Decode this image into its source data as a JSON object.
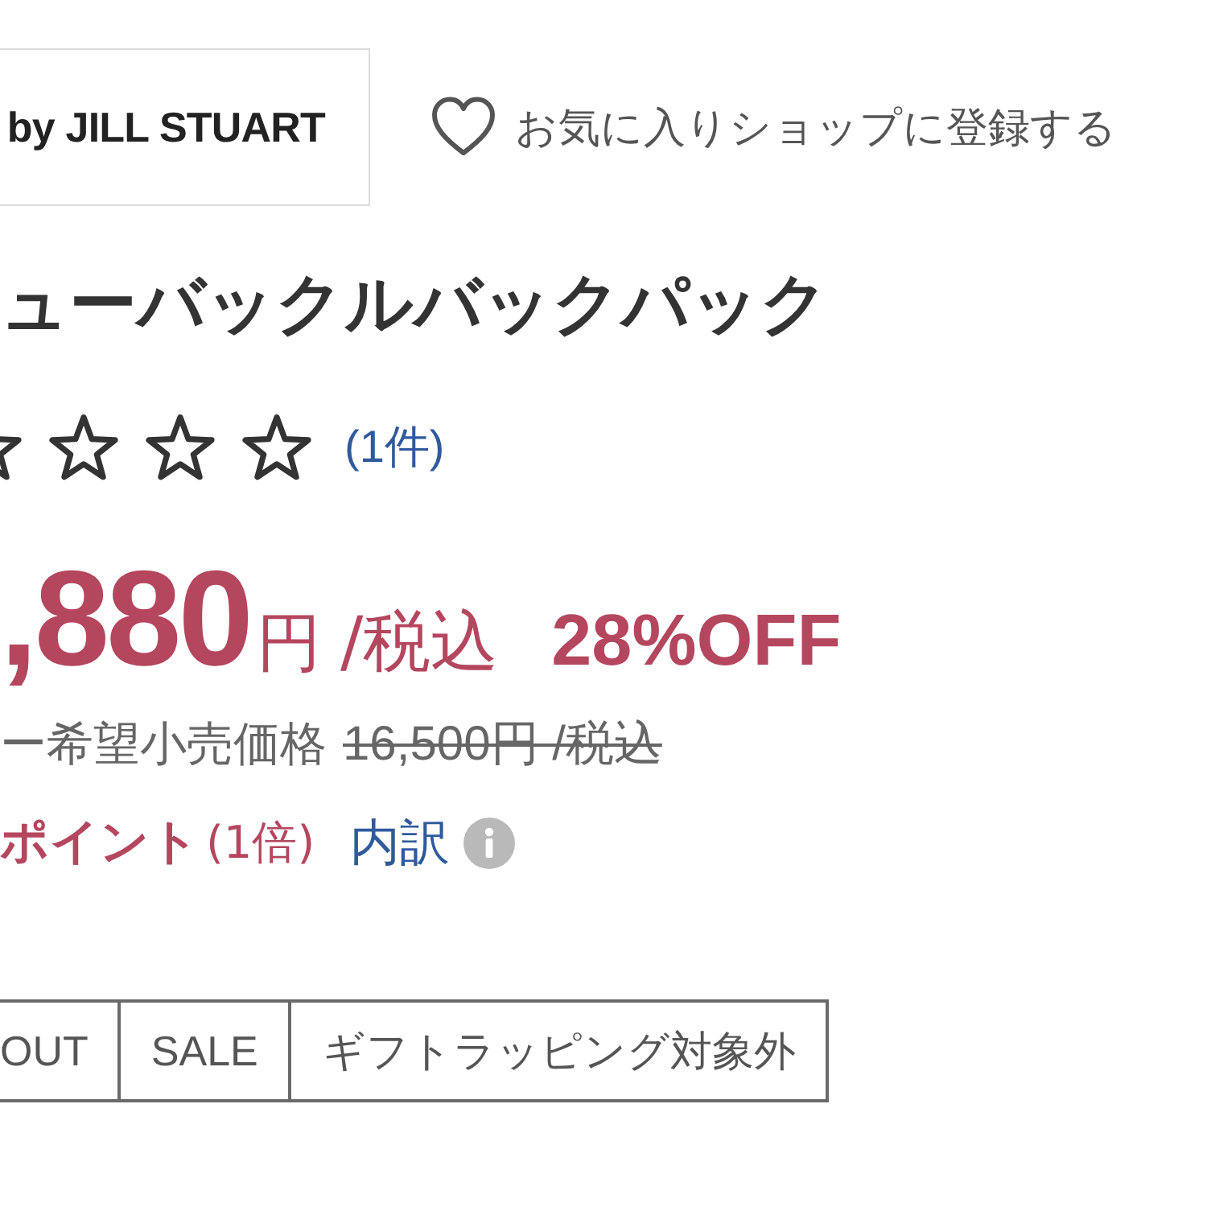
{
  "shop": {
    "logo": "by JILL STUART",
    "favorite_link": "お気に入りショップに登録する"
  },
  "product": {
    "title": "ューバックルバックパック",
    "rating": {
      "stars": 0,
      "review_count": "(1件)"
    },
    "price": {
      "amount": ",880",
      "currency": "円",
      "tax_note": "/税込",
      "discount": "28%OFF"
    },
    "list_price": {
      "label": "ー希望小売価格",
      "value": "16,500円 /税込"
    },
    "points": {
      "label": "ポイント",
      "multiplier": "(1倍)",
      "breakdown_link": "内訳"
    },
    "tags": [
      {
        "label": "OUT"
      },
      {
        "label": "SALE"
      },
      {
        "label": "ギフトラッピング対象外"
      }
    ]
  }
}
